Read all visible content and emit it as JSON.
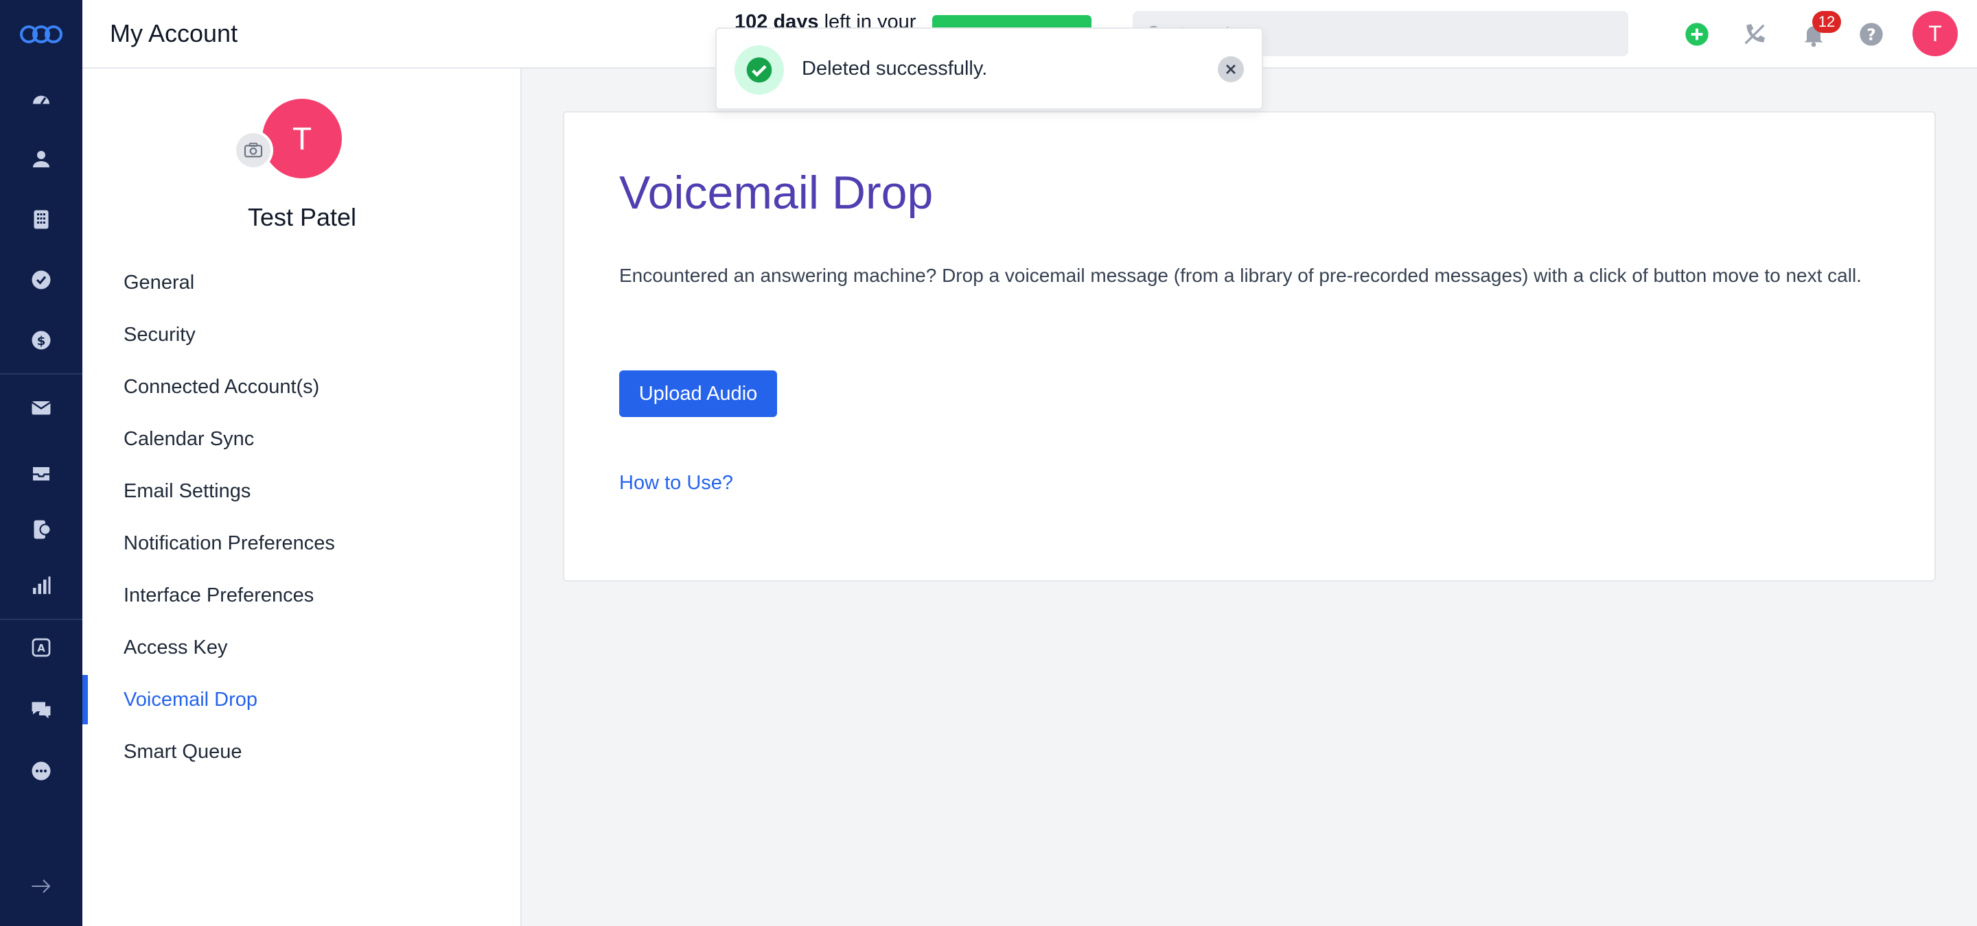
{
  "header": {
    "title": "My Account",
    "trial_days": "102 days",
    "trial_rest": " left in your",
    "search_placeholder": "Search",
    "notification_count": "12",
    "user_initial": "T"
  },
  "rail": {
    "icons": [
      "logo-icon",
      "dashboard-icon",
      "contacts-icon",
      "dialpad-icon",
      "tasks-icon",
      "deals-icon",
      "email-icon",
      "inbox-icon",
      "phone-chat-icon",
      "reports-icon",
      "automation-icon",
      "messages-icon",
      "more-icon",
      "expand-icon"
    ]
  },
  "profile": {
    "initial": "T",
    "name": "Test Patel"
  },
  "menu": {
    "items": [
      {
        "label": "General"
      },
      {
        "label": "Security"
      },
      {
        "label": "Connected Account(s)"
      },
      {
        "label": "Calendar Sync"
      },
      {
        "label": "Email Settings"
      },
      {
        "label": "Notification Preferences"
      },
      {
        "label": "Interface Preferences"
      },
      {
        "label": "Access Key"
      },
      {
        "label": "Voicemail Drop"
      },
      {
        "label": "Smart Queue"
      }
    ],
    "active": "Voicemail Drop"
  },
  "content": {
    "title": "Voicemail Drop",
    "description": "Encountered an answering machine? Drop a voicemail message (from a library of pre-recorded messages) with a click of button move to next call.",
    "upload_label": "Upload Audio",
    "howto_label": "How to Use?"
  },
  "toast": {
    "message": "Deleted successfully."
  },
  "colors": {
    "rail_bg": "#0f1f4a",
    "accent": "#2563eb",
    "title_purple": "#4f3fb0",
    "avatar_pink": "#f43f6e",
    "success_green": "#22c55e",
    "badge_red": "#dc2626"
  }
}
